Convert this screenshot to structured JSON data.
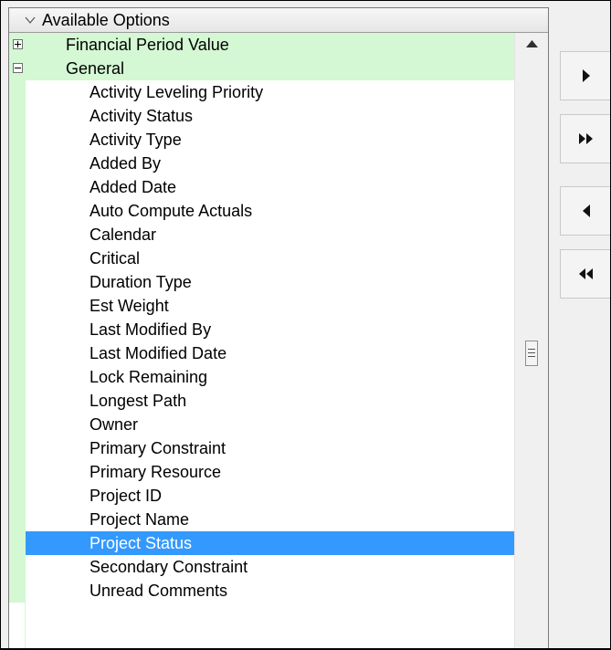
{
  "panel": {
    "header_title": "Available Options"
  },
  "groups": [
    {
      "label": "Financial Period Value",
      "state": "collapsed"
    },
    {
      "label": "General",
      "state": "expanded"
    }
  ],
  "general_items": [
    "Activity Leveling Priority",
    "Activity Status",
    "Activity Type",
    "Added By",
    "Added Date",
    "Auto Compute Actuals",
    "Calendar",
    "Critical",
    "Duration Type",
    "Est Weight",
    "Last Modified By",
    "Last Modified Date",
    "Lock Remaining",
    "Longest Path",
    "Owner",
    "Primary Constraint",
    "Primary Resource",
    "Project ID",
    "Project Name",
    "Project Status",
    "Secondary Constraint",
    "Unread Comments"
  ],
  "selected_item": "Project Status",
  "icons": {
    "header": "chevron-down-icon",
    "collapsed_group": "plus-box-icon",
    "expanded_group": "minus-box-icon",
    "scroll_up": "scroll-up-arrow-icon",
    "thumb": "scrollbar-grip-icon",
    "move_one_right": "arrow-right-icon",
    "move_all_right": "double-arrow-right-icon",
    "move_one_left": "arrow-left-icon",
    "move_all_left": "double-arrow-left-icon"
  },
  "colors": {
    "group_background": "#d4f7d4",
    "selection": "#3399ff",
    "selection_text": "#ffffff",
    "window_background": "#f0f0f0"
  }
}
